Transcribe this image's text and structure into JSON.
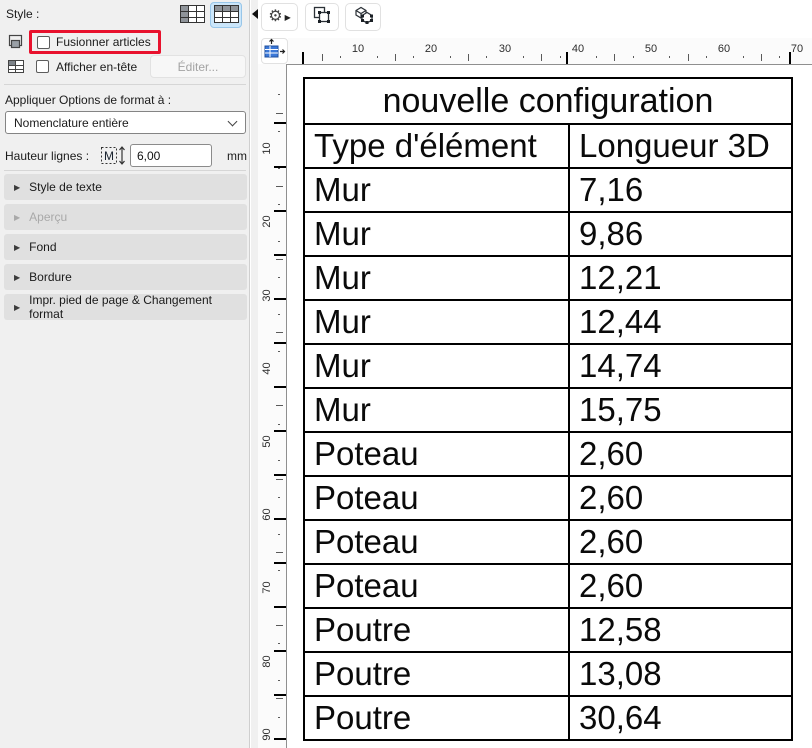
{
  "colors": {
    "annotation_red": "#e8112d",
    "panel_bg": "#f0f0f0",
    "selected_btn_bg": "#cbe6fa",
    "selected_btn_border": "#98c6e9",
    "table_line": "#000000",
    "origin_icon_blue": "#3b78d8"
  },
  "panel": {
    "style_label": "Style :",
    "style_buttons": [
      "table-style-column-accent",
      "table-style-header-accent"
    ],
    "selected_style_button": 1,
    "merge": {
      "label": "Fusionner articles",
      "checked": false,
      "highlighted": true
    },
    "header": {
      "label": "Afficher en-tête",
      "checked": false
    },
    "edit_button": "Éditer...",
    "apply_label": "Appliquer Options de format à :",
    "dropdown_value": "Nomenclature entière",
    "row_height": {
      "label": "Hauteur lignes :",
      "value": "6,00",
      "unit": "mm"
    },
    "sections": [
      {
        "label": "Style de texte",
        "disabled": false
      },
      {
        "label": "Aperçu",
        "disabled": true
      },
      {
        "label": "Fond",
        "disabled": false
      },
      {
        "label": "Bordure",
        "disabled": false
      },
      {
        "label": "Impr. pied de page & Changement format",
        "disabled": false
      }
    ]
  },
  "toolbar": {
    "icons": [
      "settings-gear",
      "marquee-2d",
      "marquee-3d"
    ]
  },
  "rulers": {
    "corner_icon": "table-resize-origin",
    "horizontal_labels": [
      "10",
      "20",
      "30",
      "40",
      "50",
      "60",
      "70"
    ],
    "vertical_labels": [
      "10",
      "20",
      "30",
      "40",
      "50",
      "60",
      "70",
      "80",
      "90"
    ]
  },
  "schedule": {
    "title": "nouvelle configuration",
    "columns": [
      "Type d'élément",
      "Longueur 3D"
    ],
    "rows": [
      [
        "Mur",
        "7,16"
      ],
      [
        "Mur",
        "9,86"
      ],
      [
        "Mur",
        "12,21"
      ],
      [
        "Mur",
        "12,44"
      ],
      [
        "Mur",
        "14,74"
      ],
      [
        "Mur",
        "15,75"
      ],
      [
        "Poteau",
        "2,60"
      ],
      [
        "Poteau",
        "2,60"
      ],
      [
        "Poteau",
        "2,60"
      ],
      [
        "Poteau",
        "2,60"
      ],
      [
        "Poutre",
        "12,58"
      ],
      [
        "Poutre",
        "13,08"
      ],
      [
        "Poutre",
        "30,64"
      ]
    ]
  }
}
